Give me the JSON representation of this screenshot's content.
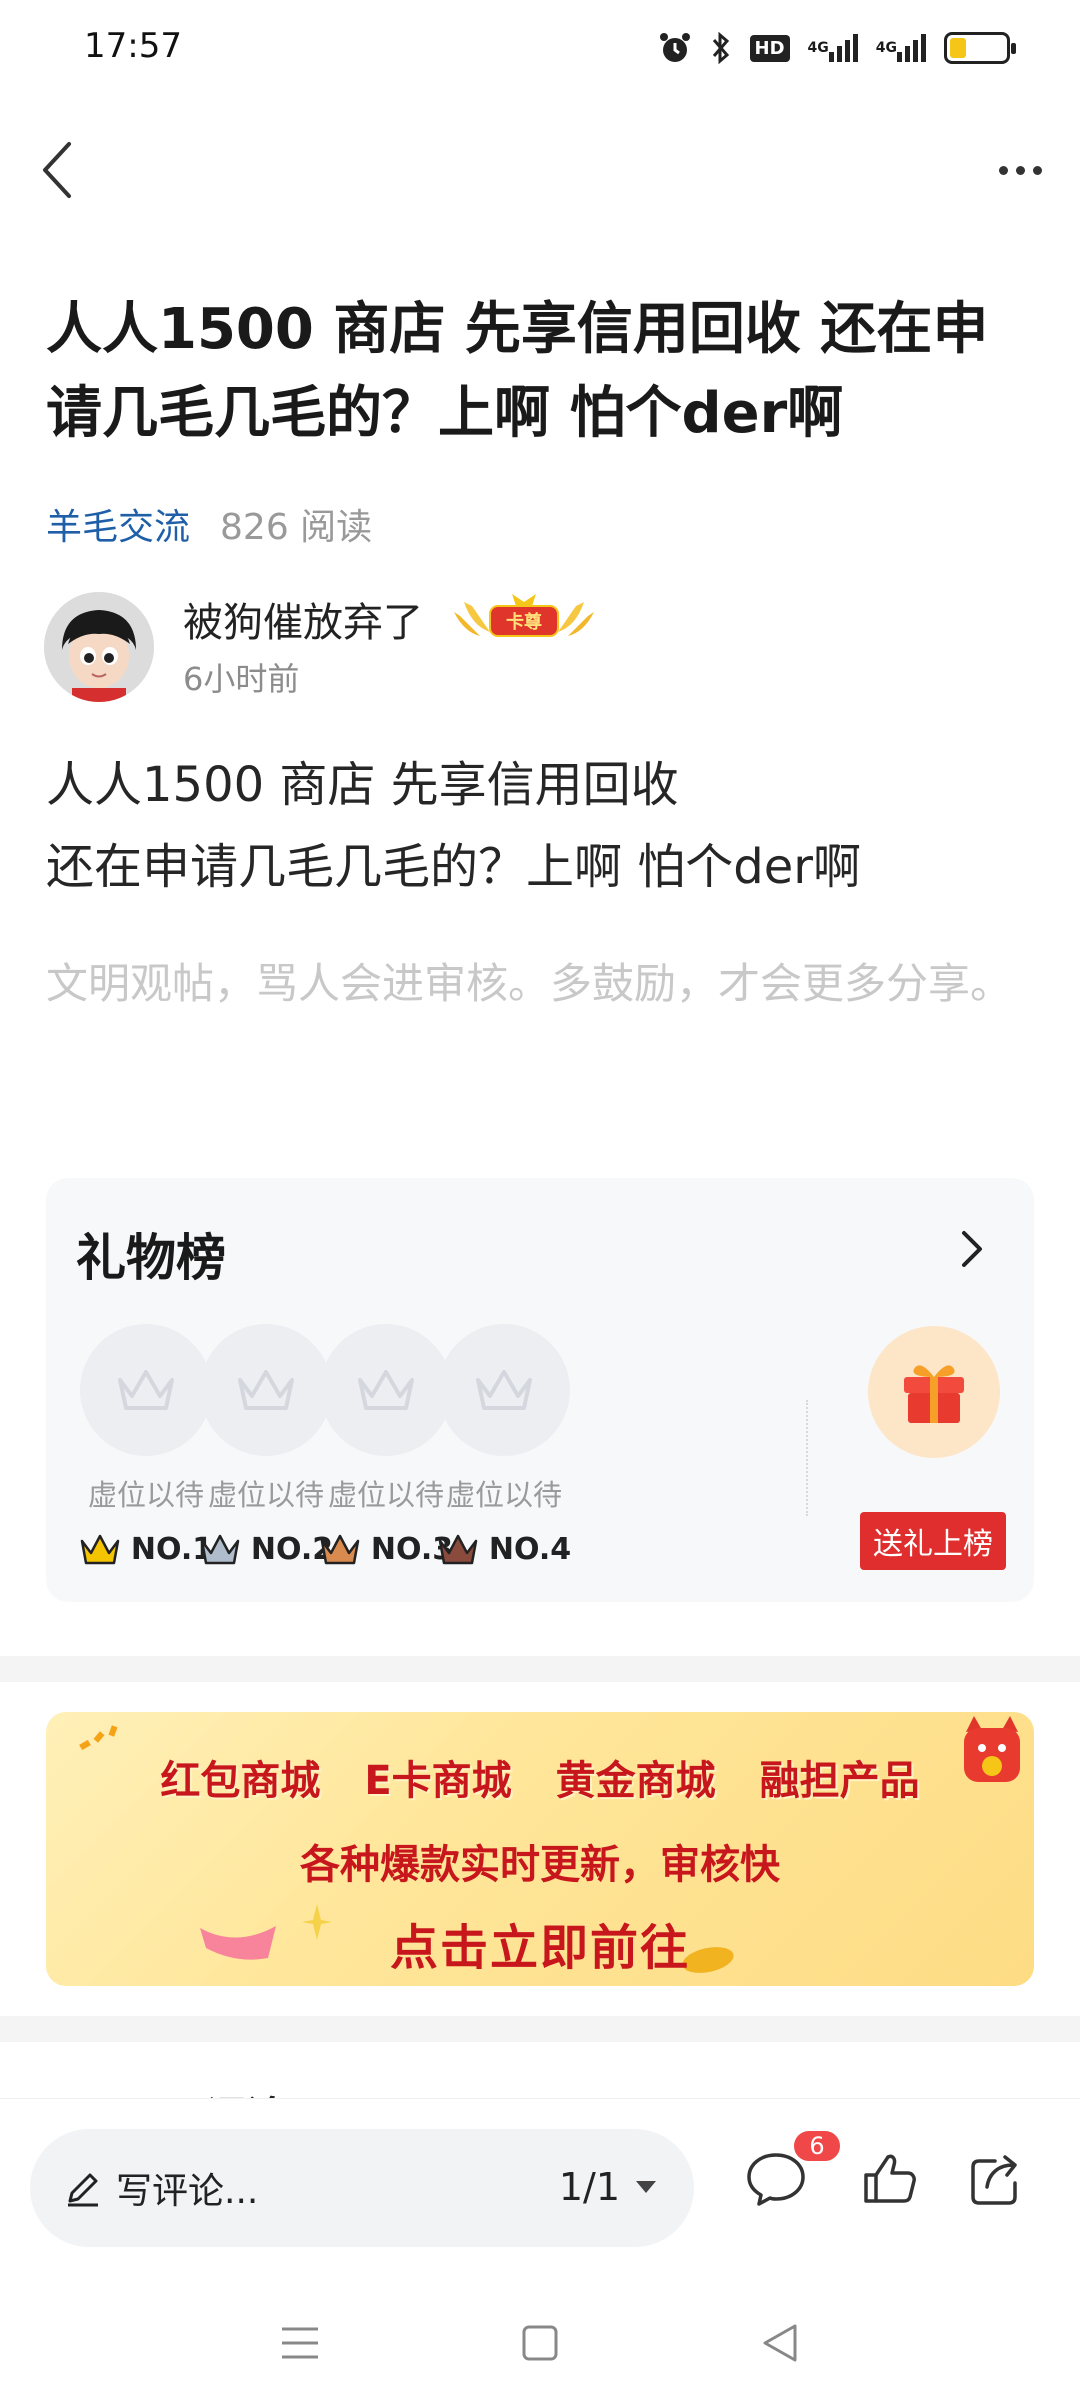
{
  "status_bar": {
    "time": "17:57",
    "hd_label": "HD",
    "net1": "4G",
    "net2": "4G",
    "battery_level": 0.3,
    "icons": [
      "alarm-icon",
      "bluetooth-icon",
      "hd-icon",
      "signal-4g-icon",
      "signal-4g-icon",
      "battery-icon"
    ]
  },
  "nav": {
    "back_icon": "chevron-left-icon",
    "more_icon": "more-horizontal-icon"
  },
  "post": {
    "title": "人人1500 商店 先享信用回收 还在申请几毛几毛的？上啊 怕个der啊",
    "forum": "羊毛交流",
    "reads": "826 阅读",
    "author": "被狗催放弃了",
    "author_badge": "卡尊",
    "time": "6小时前",
    "body_line1": "人人1500 商店 先享信用回收",
    "body_line2": "还在申请几毛几毛的？上啊 怕个der啊",
    "notice": "文明观帖，骂人会进审核。多鼓励，才会更多分享。"
  },
  "gift_board": {
    "title": "礼物榜",
    "slots": [
      {
        "label": "虚位以待",
        "rank": "NO.1",
        "crown_color": "#f5c400"
      },
      {
        "label": "虚位以待",
        "rank": "NO.2",
        "crown_color": "#aebccb"
      },
      {
        "label": "虚位以待",
        "rank": "NO.3",
        "crown_color": "#d98a4e"
      },
      {
        "label": "虚位以待",
        "rank": "NO.4",
        "crown_color": "#8a4b3c"
      }
    ],
    "send_label": "送礼上榜"
  },
  "banner": {
    "items": [
      "红包商城",
      "E卡商城",
      "黄金商城",
      "融担产品"
    ],
    "subtitle": "各种爆款实时更新，审核快",
    "cta": "点击立即前往"
  },
  "comment_header_peek": "评论",
  "bottom_bar": {
    "input_placeholder": "写评论...",
    "page_indicator": "1/1",
    "comment_count": "6"
  },
  "colors": {
    "forum_link": "#1e5fa8",
    "send_gift_bg": "#e02d2d",
    "badge_red": "#f04848",
    "banner_text": "#c8161d"
  }
}
